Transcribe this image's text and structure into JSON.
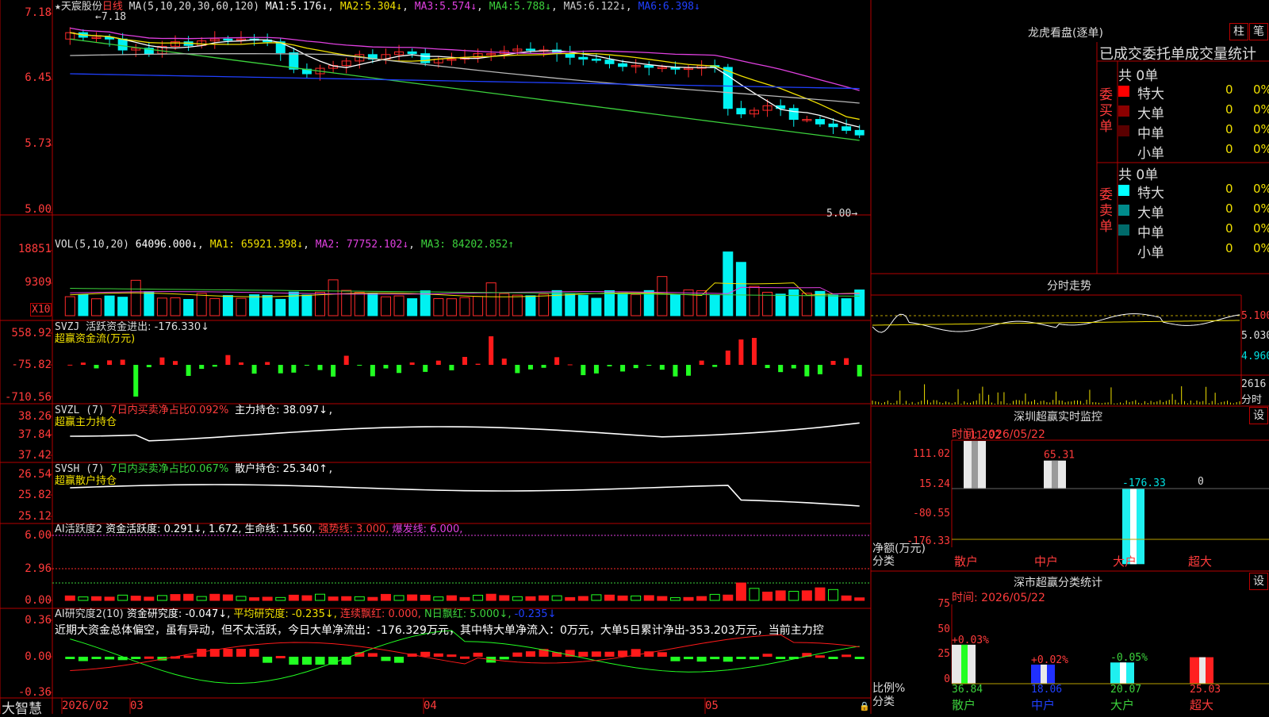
{
  "colors": {
    "up": "#ff2a2a",
    "down": "#00f2f2",
    "frame": "#b40000",
    "yellow": "#f0e000",
    "magenta": "#e040e0",
    "green": "#3cd23c",
    "white": "#ffffff",
    "gray": "#b8b8b8",
    "blue": "#2040ff"
  },
  "main": {
    "header": {
      "name": "★天宸股份",
      "period": "日线",
      "ma_label": "MA(5,10,20,30,60,120)",
      "ma": [
        {
          "label": "MA1:",
          "value": "5.176↓"
        },
        {
          "label": "MA2:",
          "value": "5.304↓"
        },
        {
          "label": "MA3:",
          "value": "5.574↓"
        },
        {
          "label": "MA4:",
          "value": "5.788↓"
        },
        {
          "label": "MA5:",
          "value": "6.122↓"
        },
        {
          "label": "MA6:",
          "value": "6.398↓"
        }
      ]
    },
    "y_ticks": [
      "7.18",
      "6.45",
      "5.73",
      "5.00"
    ],
    "hi_label": "7.18",
    "lo_label": "5.00"
  },
  "vol": {
    "header": {
      "label": "VOL(5,10,20)",
      "value": "64096.000↓",
      "ma1": "MA1: 65921.398↓",
      "ma2": "MA2: 77752.102↓",
      "ma3": "MA3: 84202.852↑"
    },
    "y_ticks": [
      "18851",
      "9309"
    ],
    "unit": "X10"
  },
  "svzj": {
    "header": {
      "label": "SVZJ",
      "text": "活跃资金进出: -176.330↓",
      "sub": "超赢资金流(万元)"
    },
    "y_ticks": [
      "558.92",
      "-75.82",
      "-710.56"
    ]
  },
  "svzl": {
    "header": {
      "label": "SVZL (7)",
      "ratio": "7日内买卖净占比0.092%",
      "hold": "主力持仓: 38.097↓",
      "sub": "超赢主力持仓"
    },
    "y_ticks": [
      "38.26",
      "37.84",
      "37.42"
    ]
  },
  "svsh": {
    "header": {
      "label": "SVSH (7)",
      "ratio": "7日内买卖净占比0.067%",
      "hold": "散户持仓: 25.340↑",
      "sub": "超赢散户持仓"
    },
    "y_ticks": [
      "26.54",
      "25.82",
      "25.12"
    ]
  },
  "ai1": {
    "header": {
      "label": "AI活跃度2",
      "a": "资金活跃度: 0.291↓, 1.672,",
      "b": "生命线: 1.560,",
      "c": "强势线: 3.000,",
      "d": "爆发线: 6.000,"
    },
    "y_ticks": [
      "6.00",
      "2.96",
      "0.00"
    ]
  },
  "ai2": {
    "header": {
      "label": "AI研究度2(10)",
      "a": "资金研究度: -0.047↓,",
      "b": "平均研究度: -0.235↓,",
      "c": "连续飘红: 0.000,",
      "d": "N日飘红: 5.000↓,",
      "e": "-0.235↓"
    },
    "note": "近期大资金总体偏空，虽有异动，但不太活跃，今日大单净流出：-176.329万元，其中特大单净流入：0万元，大单5日累计净出-353.203万元，当前主力控",
    "y_ticks": [
      "0.36",
      "0.00",
      "-0.36"
    ]
  },
  "bottom": {
    "brand": "大智慧",
    "dates": [
      "2026/02",
      "03",
      "04",
      "05"
    ]
  },
  "lhb": {
    "title": "龙虎看盘(逐单)",
    "btn1": "柱",
    "btn2": "笔",
    "heading": "已成交委托单成交量统计",
    "buy": {
      "label": "委买单",
      "total": "共 0单",
      "rows": [
        {
          "name": "特大",
          "v": "0",
          "p": "0%",
          "c": "#ff0000"
        },
        {
          "name": "大单",
          "v": "0",
          "p": "0%",
          "c": "#8b0000"
        },
        {
          "name": "中单",
          "v": "0",
          "p": "0%",
          "c": "#5a0000"
        },
        {
          "name": "小单",
          "v": "0",
          "p": "0%",
          "c": "#000000"
        }
      ]
    },
    "sell": {
      "label": "委卖单",
      "total": "共 0单",
      "rows": [
        {
          "name": "特大",
          "v": "0",
          "p": "0%",
          "c": "#00ffff"
        },
        {
          "name": "大单",
          "v": "0",
          "p": "0%",
          "c": "#008b8b"
        },
        {
          "name": "中单",
          "v": "0",
          "p": "0%",
          "c": "#006a6a"
        },
        {
          "name": "小单",
          "v": "0",
          "p": "0%",
          "c": "#000000"
        }
      ]
    }
  },
  "intraday": {
    "title": "分时走势",
    "y_ticks": [
      "5.100",
      "5.030",
      "4.960"
    ],
    "vol": "2616",
    "vol_label": "分时"
  },
  "monitor": {
    "title": "深圳超赢实时监控",
    "btn": "设",
    "time": "时间: 2026/05/22",
    "y_ticks": [
      "111.02",
      "15.24",
      "-80.55",
      "-176.33"
    ],
    "unit1": "净额(万元)",
    "unit2": "分类",
    "bars": [
      {
        "cat": "散户",
        "value": 111.02,
        "label": "111.02"
      },
      {
        "cat": "中户",
        "value": 65.31,
        "label": "65.31"
      },
      {
        "cat": "大户",
        "value": -176.33,
        "label": "-176.33"
      },
      {
        "cat": "超大",
        "value": 0,
        "label": "0"
      }
    ]
  },
  "classify": {
    "title": "深市超赢分类统计",
    "btn": "设",
    "time": "时间: 2026/05/22",
    "y_ticks": [
      "75",
      "50",
      "25",
      "0"
    ],
    "unit1": "比例%",
    "unit2": "分类",
    "bars": [
      {
        "cat": "散户",
        "value": 36.84,
        "label": "36.84",
        "chg": "+0.03%"
      },
      {
        "cat": "中户",
        "value": 18.06,
        "label": "18.06",
        "chg": "+0.02%"
      },
      {
        "cat": "大户",
        "value": 20.07,
        "label": "20.07",
        "chg": "-0.05%"
      },
      {
        "cat": "超大",
        "value": 25.03,
        "label": "25.03",
        "chg": ""
      }
    ]
  }
}
